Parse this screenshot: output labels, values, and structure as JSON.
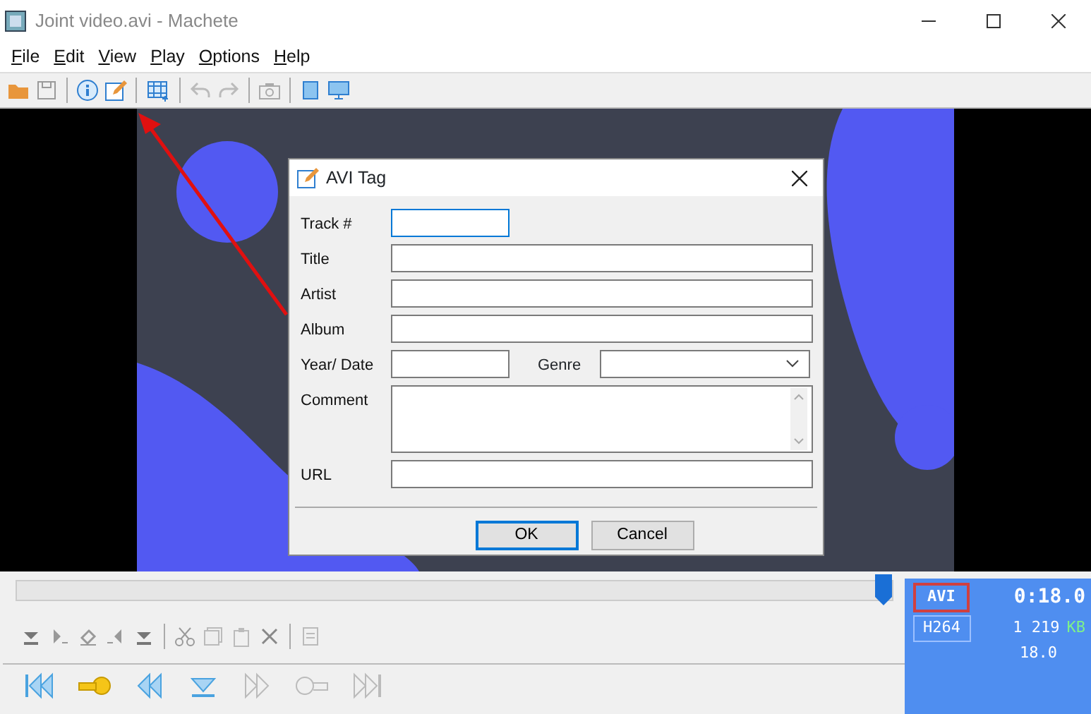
{
  "window": {
    "title": "Joint video.avi - Machete"
  },
  "menu": [
    "File",
    "Edit",
    "View",
    "Play",
    "Options",
    "Help"
  ],
  "dialog": {
    "title": "AVI Tag",
    "fields": [
      {
        "label": "Track #",
        "kind": "short",
        "focused": true
      },
      {
        "label": "Title",
        "kind": "text",
        "focused": false
      },
      {
        "label": "Artist",
        "kind": "text",
        "focused": false
      },
      {
        "label": "Album",
        "kind": "text",
        "focused": false
      },
      {
        "label": "Year/ Date",
        "kind": "short",
        "focused": false,
        "extra": {
          "label": "Genre",
          "kind": "select"
        }
      },
      {
        "label": "Comment",
        "kind": "memo",
        "focused": false
      },
      {
        "label": "URL",
        "kind": "text",
        "focused": false
      }
    ],
    "buttons": [
      {
        "label": "OK",
        "default": true
      },
      {
        "label": "Cancel",
        "default": false
      }
    ]
  },
  "seek": {
    "level": 0.99
  },
  "info": {
    "container": "AVI",
    "time": "0:18.0",
    "codec": "H264",
    "size": "1 219",
    "unit": "KB",
    "fps": "18.0"
  }
}
